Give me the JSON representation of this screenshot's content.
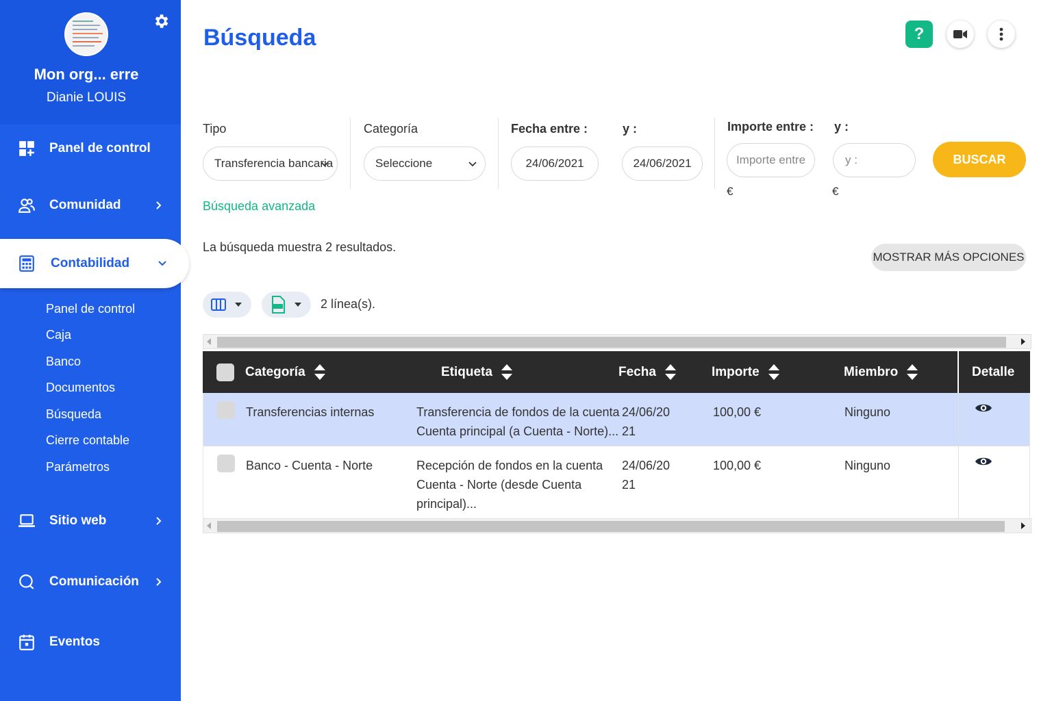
{
  "sidebar": {
    "org_name": "Mon org... erre",
    "user_name": "Dianie LOUIS",
    "items": [
      {
        "label": "Panel de control",
        "icon": "dashboard-icon"
      },
      {
        "label": "Comunidad",
        "icon": "users-icon"
      },
      {
        "label": "Contabilidad",
        "icon": "calculator-icon"
      },
      {
        "label": "Sitio web",
        "icon": "laptop-icon"
      },
      {
        "label": "Comunicación",
        "icon": "chat-icon"
      },
      {
        "label": "Eventos",
        "icon": "calendar-icon"
      }
    ],
    "subitems": [
      "Panel de control",
      "Caja",
      "Banco",
      "Documentos",
      "Búsqueda",
      "Cierre contable",
      "Parámetros"
    ]
  },
  "header": {
    "title": "Búsqueda",
    "help_label": "?"
  },
  "filters": {
    "tipo_label": "Tipo",
    "tipo_value": "Transferencia bancaria",
    "categoria_label": "Categoría",
    "categoria_value": "Seleccione",
    "fecha_label": "Fecha entre :",
    "fecha_y_label": "y :",
    "fecha_from": "24/06/2021",
    "fecha_to": "24/06/2021",
    "importe_label": "Importe entre :",
    "importe_y_label": "y :",
    "importe_from_placeholder": "Importe entre",
    "importe_to_placeholder": "y :",
    "currency": "€",
    "search_button": "BUSCAR",
    "advanced_link": "Búsqueda avanzada"
  },
  "results": {
    "summary": "La búsqueda muestra 2 resultados.",
    "more_options": "MOSTRAR MÁS OPCIONES",
    "lines": "2 línea(s)."
  },
  "table": {
    "columns": [
      "Categoría",
      "Etiqueta",
      "Fecha",
      "Importe",
      "Miembro",
      "Detalle"
    ],
    "rows": [
      {
        "categoria": "Transferencias internas",
        "etiqueta_1": "Transferencia de fondos de la cuenta",
        "etiqueta_2": "Cuenta principal (a Cuenta - Norte)...",
        "etiqueta_3": "",
        "fecha_1": "24/06/20",
        "fecha_2": "21",
        "importe": "100,00 €",
        "miembro": "Ninguno"
      },
      {
        "categoria": "Banco - Cuenta - Norte",
        "etiqueta_1": "Recepción de fondos en la cuenta",
        "etiqueta_2": "Cuenta - Norte (desde Cuenta",
        "etiqueta_3": "principal)...",
        "fecha_1": "24/06/20",
        "fecha_2": "21",
        "importe": "100,00 €",
        "miembro": "Ninguno"
      }
    ]
  },
  "colors": {
    "sidebar": "#1f5ee8",
    "accent_green": "#12b886",
    "button_yellow": "#f7b718",
    "selected_row": "#cfdcfc",
    "table_header": "#2b2b2b"
  }
}
